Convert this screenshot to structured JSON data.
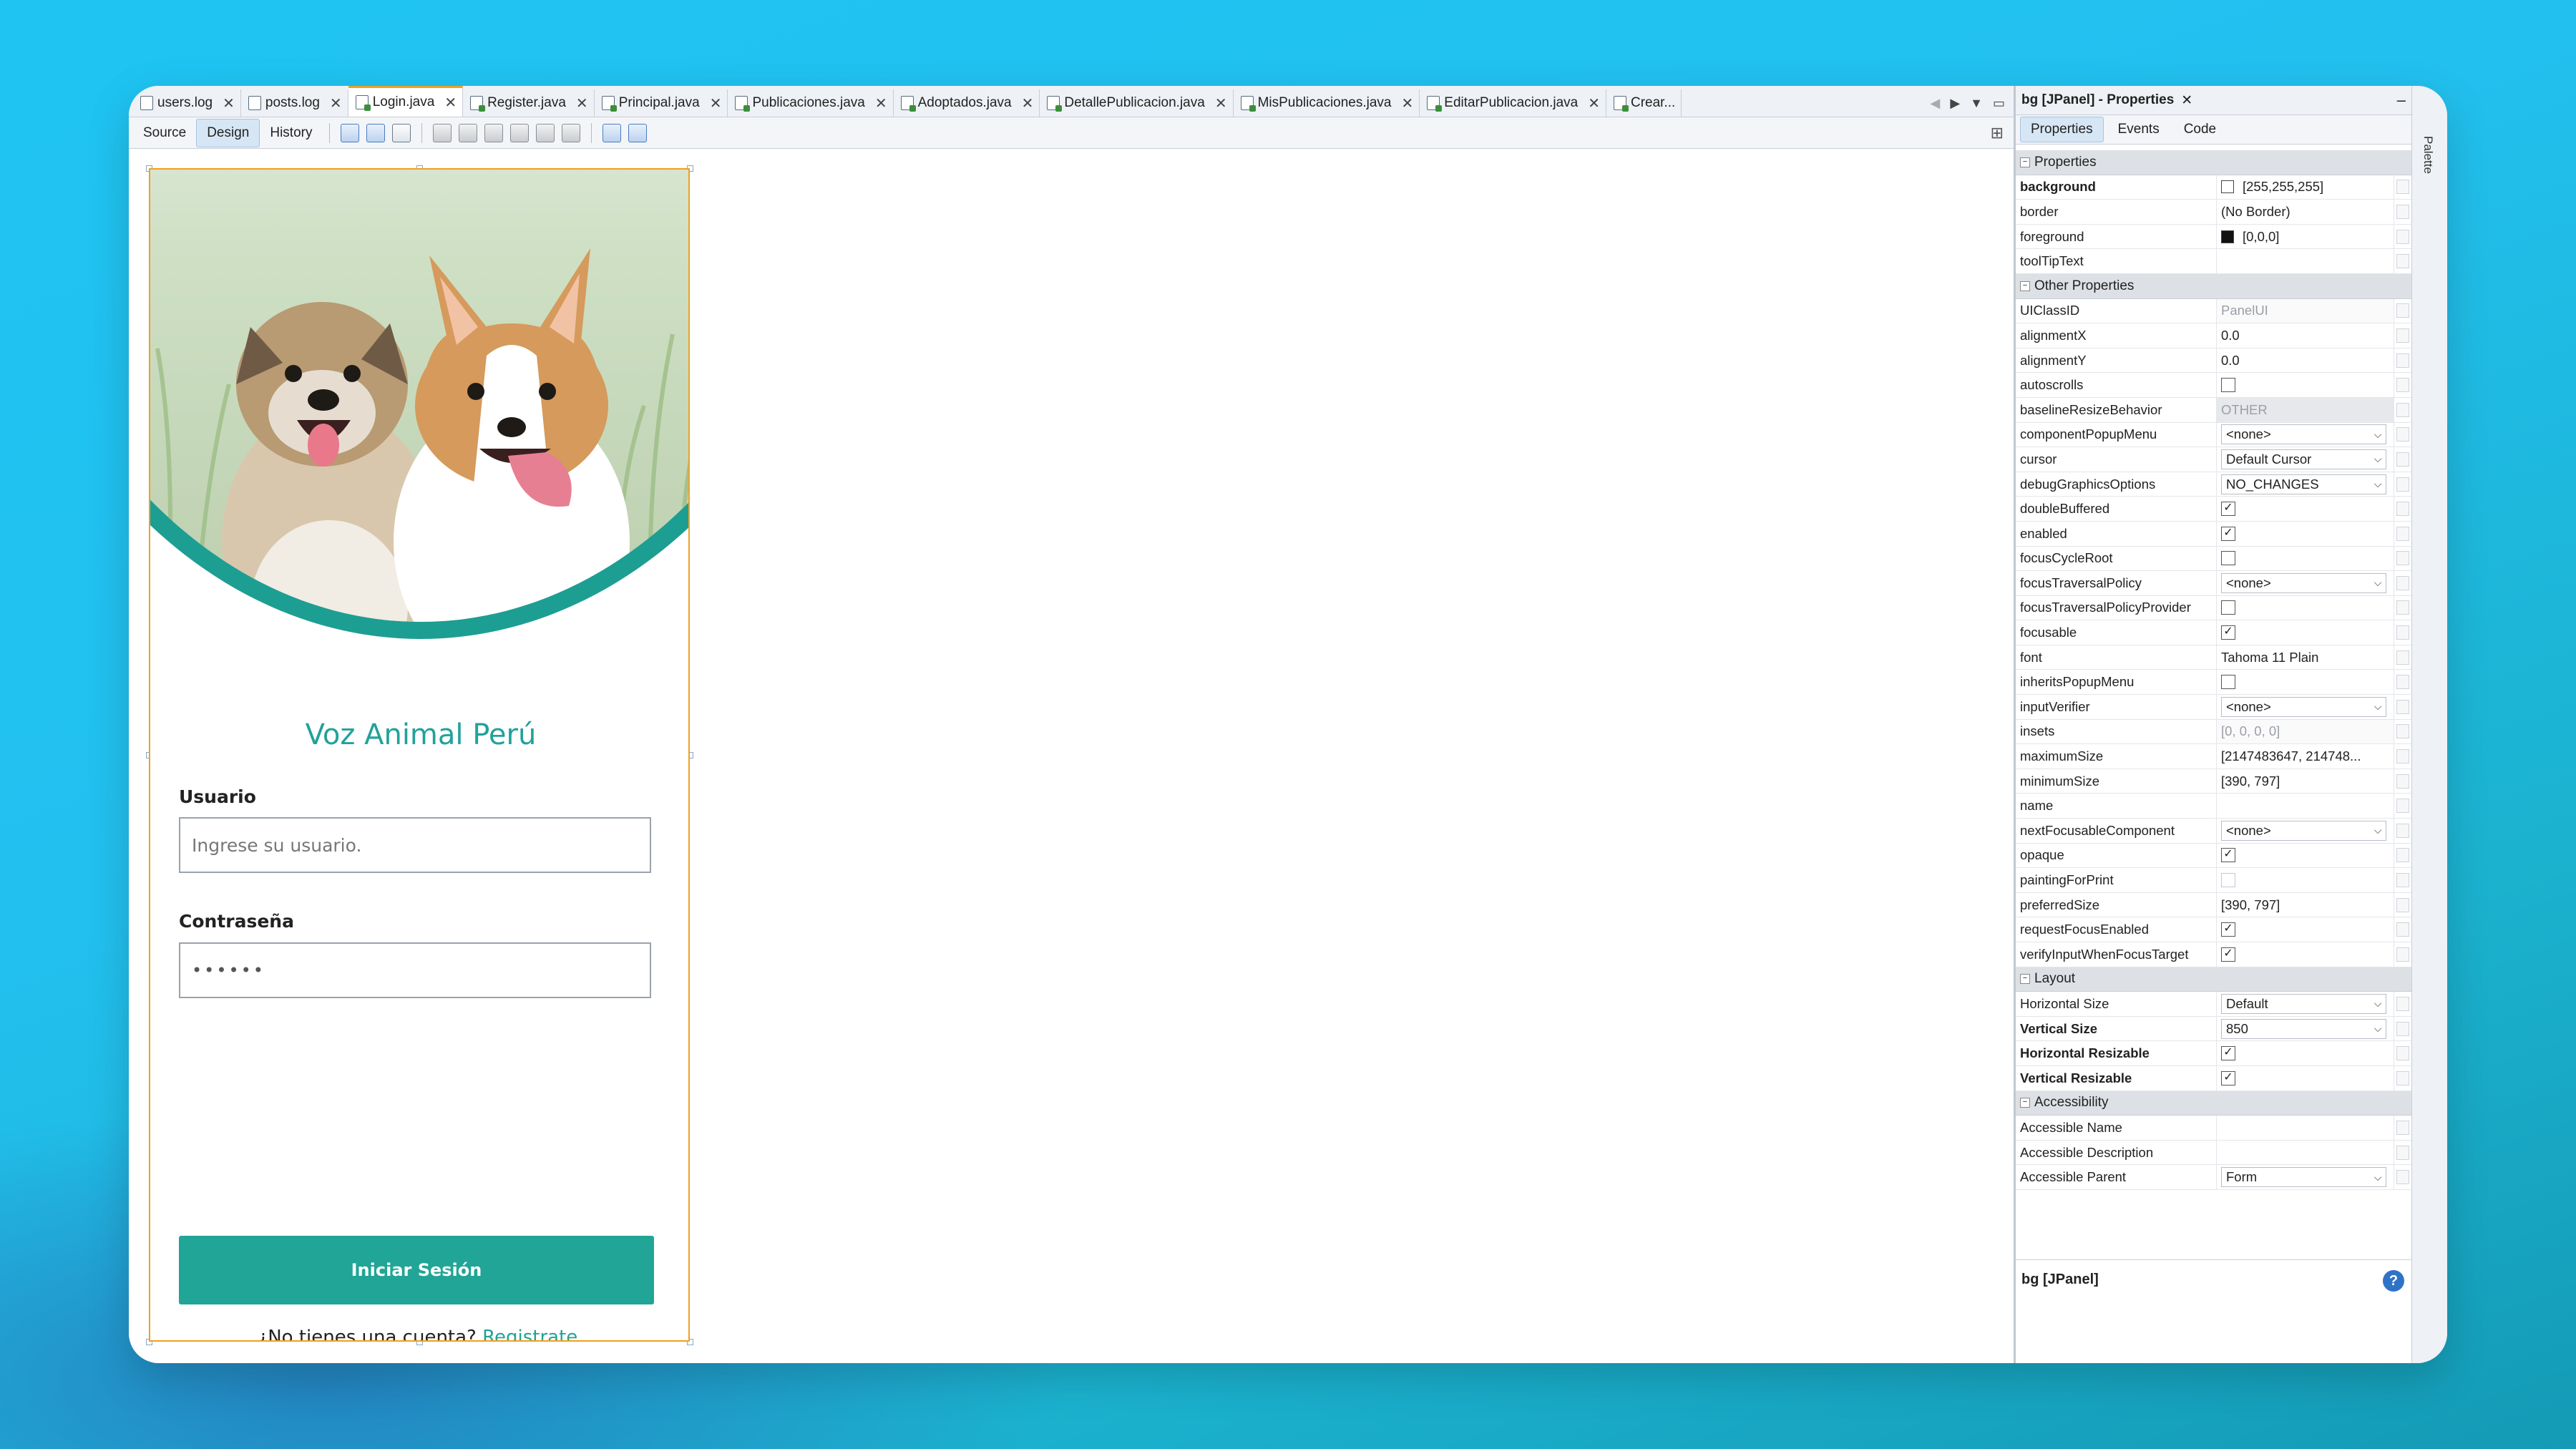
{
  "tabs": [
    {
      "label": "users.log",
      "type": "file",
      "active": false
    },
    {
      "label": "posts.log",
      "type": "file",
      "active": false
    },
    {
      "label": "Login.java",
      "type": "java",
      "active": true
    },
    {
      "label": "Register.java",
      "type": "java",
      "active": false
    },
    {
      "label": "Principal.java",
      "type": "java",
      "active": false
    },
    {
      "label": "Publicaciones.java",
      "type": "java",
      "active": false
    },
    {
      "label": "Adoptados.java",
      "type": "java",
      "active": false
    },
    {
      "label": "DetallePublicacion.java",
      "type": "java",
      "active": false
    },
    {
      "label": "MisPublicaciones.java",
      "type": "java",
      "active": false
    },
    {
      "label": "EditarPublicacion.java",
      "type": "java",
      "active": false
    },
    {
      "label": "Crear...",
      "type": "java",
      "active": false
    }
  ],
  "toolbar": {
    "source": "Source",
    "design": "Design",
    "history": "History"
  },
  "form": {
    "brand": "Voz Animal Perú",
    "user_label": "Usuario",
    "user_placeholder": "Ingrese su usuario.",
    "pass_label": "Contraseña",
    "pass_value": "••••••",
    "login_button": "Iniciar Sesión",
    "signup_text": "¿No tienes una cuenta? ",
    "signup_link": "Registrate."
  },
  "properties": {
    "title": "bg [JPanel] - Properties",
    "tabs": [
      "Properties",
      "Events",
      "Code"
    ],
    "footer": "bg [JPanel]",
    "palette_label": "Palette",
    "rows": [
      {
        "section": "Properties"
      },
      {
        "name": "background",
        "bold": true,
        "kind": "color",
        "swatch": "#ffffff",
        "value": "[255,255,255]"
      },
      {
        "name": "border",
        "kind": "text",
        "value": "(No Border)"
      },
      {
        "name": "foreground",
        "kind": "color",
        "swatch": "#111111",
        "value": "[0,0,0]"
      },
      {
        "name": "toolTipText",
        "kind": "text",
        "value": ""
      },
      {
        "section": "Other Properties"
      },
      {
        "name": "UIClassID",
        "kind": "gray",
        "value": "PanelUI"
      },
      {
        "name": "alignmentX",
        "kind": "text",
        "value": "0.0"
      },
      {
        "name": "alignmentY",
        "kind": "text",
        "value": "0.0"
      },
      {
        "name": "autoscrolls",
        "kind": "check",
        "checked": false
      },
      {
        "name": "baselineResizeBehavior",
        "kind": "disabled",
        "value": "OTHER"
      },
      {
        "name": "componentPopupMenu",
        "kind": "dropdown",
        "value": "<none>"
      },
      {
        "name": "cursor",
        "kind": "dropdown",
        "value": "Default Cursor"
      },
      {
        "name": "debugGraphicsOptions",
        "kind": "dropdown",
        "value": "NO_CHANGES"
      },
      {
        "name": "doubleBuffered",
        "kind": "check",
        "checked": true
      },
      {
        "name": "enabled",
        "kind": "check",
        "checked": true
      },
      {
        "name": "focusCycleRoot",
        "kind": "check",
        "checked": false
      },
      {
        "name": "focusTraversalPolicy",
        "kind": "dropdown",
        "value": "<none>"
      },
      {
        "name": "focusTraversalPolicyProvider",
        "kind": "check",
        "checked": false
      },
      {
        "name": "focusable",
        "kind": "check",
        "checked": true
      },
      {
        "name": "font",
        "kind": "text",
        "value": "Tahoma 11 Plain"
      },
      {
        "name": "inheritsPopupMenu",
        "kind": "check",
        "checked": false
      },
      {
        "name": "inputVerifier",
        "kind": "dropdown",
        "value": "<none>"
      },
      {
        "name": "insets",
        "kind": "gray",
        "value": "[0, 0, 0, 0]"
      },
      {
        "name": "maximumSize",
        "kind": "text",
        "value": "[2147483647, 214748..."
      },
      {
        "name": "minimumSize",
        "kind": "text",
        "value": "[390, 797]"
      },
      {
        "name": "name",
        "kind": "text",
        "value": ""
      },
      {
        "name": "nextFocusableComponent",
        "kind": "dropdown",
        "value": "<none>"
      },
      {
        "name": "opaque",
        "kind": "check",
        "checked": true
      },
      {
        "name": "paintingForPrint",
        "kind": "check-dim",
        "checked": false
      },
      {
        "name": "preferredSize",
        "kind": "text",
        "value": "[390, 797]"
      },
      {
        "name": "requestFocusEnabled",
        "kind": "check",
        "checked": true
      },
      {
        "name": "verifyInputWhenFocusTarget",
        "kind": "check",
        "checked": true
      },
      {
        "section": "Layout"
      },
      {
        "name": "Horizontal Size",
        "kind": "dropdown",
        "value": "Default"
      },
      {
        "name": "Vertical Size",
        "bold": true,
        "kind": "dropdown",
        "value": "850"
      },
      {
        "name": "Horizontal Resizable",
        "bold": true,
        "kind": "check",
        "checked": true
      },
      {
        "name": "Vertical Resizable",
        "bold": true,
        "kind": "check",
        "checked": true
      },
      {
        "section": "Accessibility"
      },
      {
        "name": "Accessible Name",
        "kind": "text",
        "value": ""
      },
      {
        "name": "Accessible Description",
        "kind": "text",
        "value": ""
      },
      {
        "name": "Accessible Parent",
        "kind": "dropdown",
        "value": "Form"
      }
    ]
  },
  "colors": {
    "accent": "#21a29a",
    "button": "#21a596",
    "selection": "#f0a020"
  }
}
